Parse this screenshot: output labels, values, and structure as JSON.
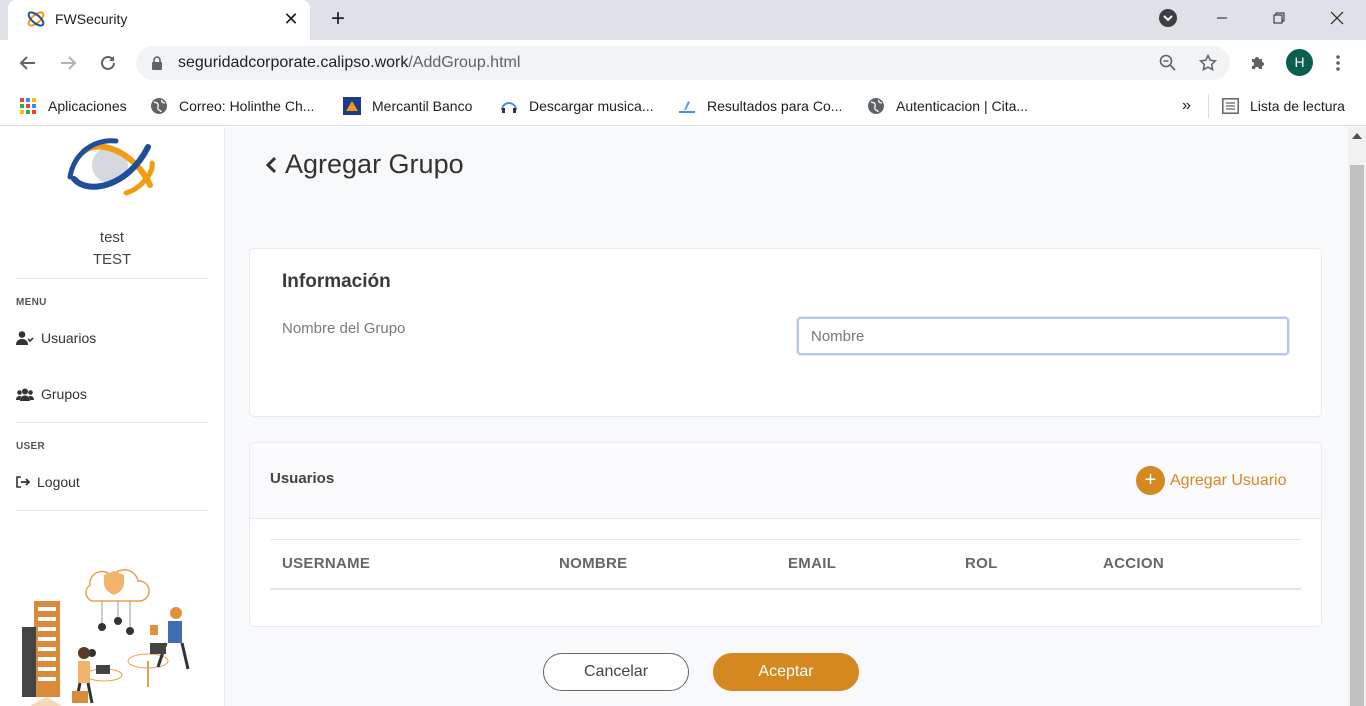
{
  "browser": {
    "tab_title": "FWSecurity",
    "tab_close": "✕",
    "new_tab": "+",
    "url_host": "seguridadcorporate.calipso.work",
    "url_path": "/AddGroup.html",
    "profile_initial": "H",
    "bookmarks": [
      {
        "label": "Aplicaciones",
        "icon": "apps-grid-icon"
      },
      {
        "label": "Correo: Holinthe Ch...",
        "icon": "globe-icon"
      },
      {
        "label": "Mercantil Banco",
        "icon": "mercantil-icon"
      },
      {
        "label": "Descargar musica...",
        "icon": "music-icon"
      },
      {
        "label": "Resultados para Co...",
        "icon": "results-icon"
      },
      {
        "label": "Autenticacion | Cita...",
        "icon": "globe-icon"
      }
    ],
    "bookmarks_overflow": "»",
    "reading_list": "Lista de lectura"
  },
  "sidebar": {
    "user_name": "test",
    "user_role": "TEST",
    "menu_label": "MENU",
    "menu_items": [
      {
        "label": "Usuarios",
        "icon": "user-icon"
      },
      {
        "label": "Grupos",
        "icon": "users-group-icon"
      }
    ],
    "user_label": "USER",
    "user_items": [
      {
        "label": "Logout",
        "icon": "logout-icon"
      }
    ]
  },
  "main": {
    "title": "Agregar Grupo",
    "info_card": {
      "title": "Información",
      "field_label": "Nombre del Grupo",
      "field_placeholder": "Nombre",
      "field_value": ""
    },
    "users_card": {
      "title": "Usuarios",
      "add_button": "Agregar Usuario",
      "columns": [
        "USERNAME",
        "NOMBRE",
        "EMAIL",
        "ROL",
        "ACCION"
      ]
    },
    "cancel_button": "Cancelar",
    "accept_button": "Aceptar"
  },
  "colors": {
    "accent": "#d4881f",
    "profile": "#0b5f4e",
    "tabstrip": "#dee1e6"
  }
}
